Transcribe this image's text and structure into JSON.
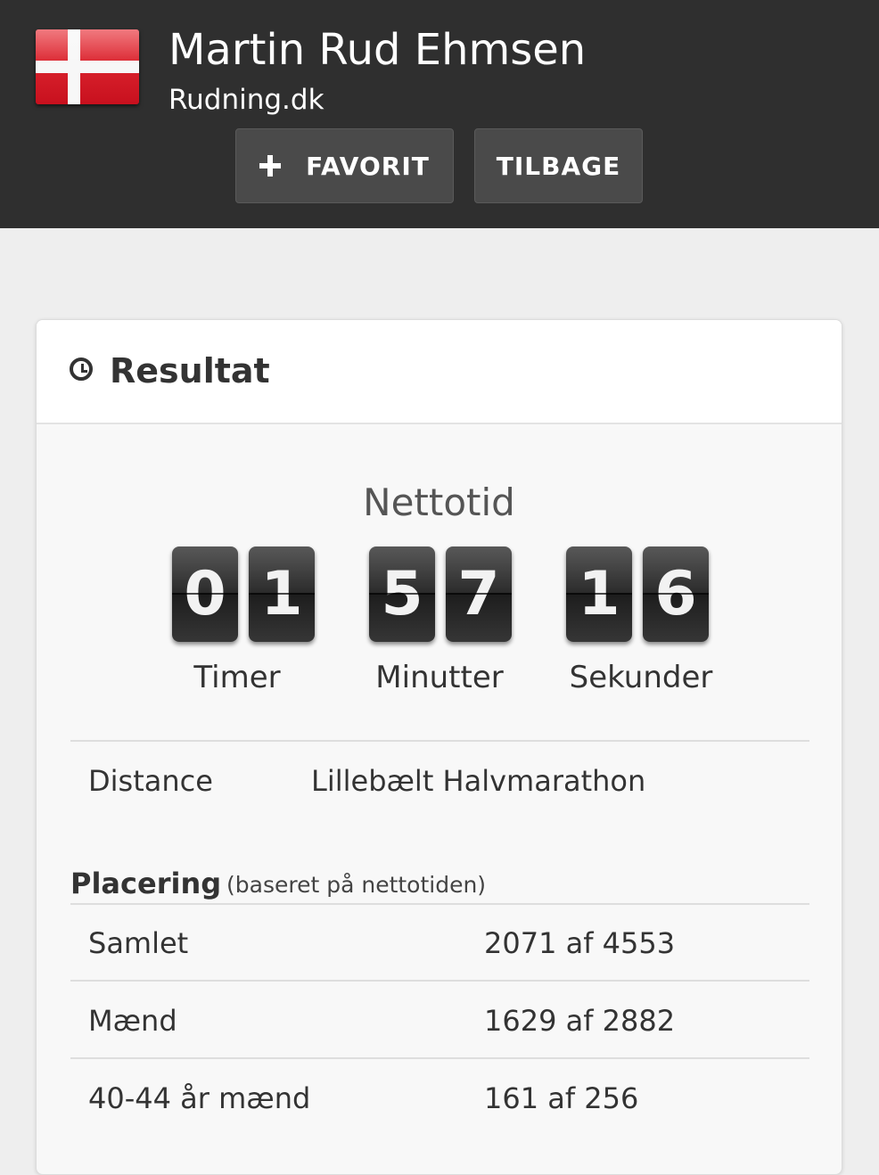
{
  "header": {
    "runner_name": "Martin Rud Ehmsen",
    "club": "Rudning.dk",
    "flag_icon": "denmark-flag-icon",
    "favorite_label": "FAVORIT",
    "back_label": "TILBAGE"
  },
  "result": {
    "title": "Resultat",
    "net_time_label": "Nettotid",
    "hours": [
      "0",
      "1"
    ],
    "minutes": [
      "5",
      "7"
    ],
    "seconds": [
      "1",
      "6"
    ],
    "hours_label": "Timer",
    "minutes_label": "Minutter",
    "seconds_label": "Sekunder",
    "distance_label": "Distance",
    "distance_value": "Lillebælt Halvmarathon"
  },
  "placement": {
    "title": "Placering",
    "note": "(baseret på nettotiden)",
    "rows": [
      {
        "label": "Samlet",
        "value": "2071 af 4553"
      },
      {
        "label": "Mænd",
        "value": "1629 af 2882"
      },
      {
        "label": "40-44 år mænd",
        "value": "161 af 256"
      }
    ]
  },
  "colors": {
    "topbar": "#2f2f2f",
    "button": "#4a4a4a",
    "page_bg": "#eeeeee"
  }
}
